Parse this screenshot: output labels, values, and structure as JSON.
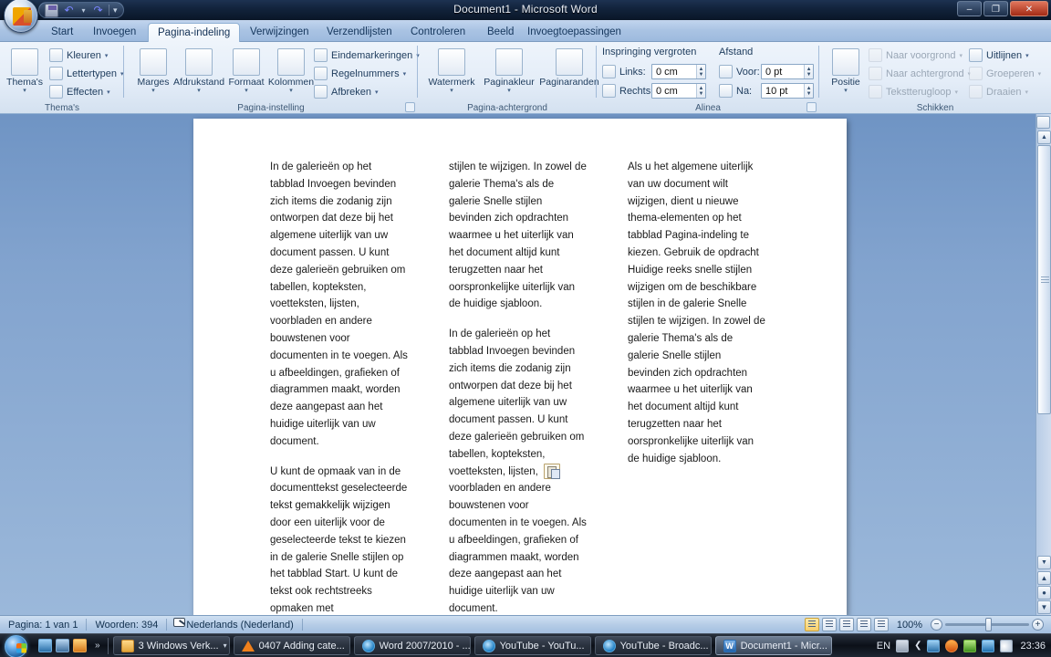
{
  "window": {
    "title": "Document1 - Microsoft Word",
    "minimize_label": "–",
    "restore_label": "❐",
    "close_label": "✕"
  },
  "quick_access": {
    "save_name": "save-icon",
    "undo_name": "undo-icon",
    "redo_name": "redo-icon",
    "customize_label": "▾"
  },
  "tabs": [
    {
      "label": "Start",
      "active": false
    },
    {
      "label": "Invoegen",
      "active": false
    },
    {
      "label": "Pagina-indeling",
      "active": true
    },
    {
      "label": "Verwijzingen",
      "active": false
    },
    {
      "label": "Verzendlijsten",
      "active": false
    },
    {
      "label": "Controleren",
      "active": false
    },
    {
      "label": "Beeld",
      "active": false
    },
    {
      "label": "Invoegtoepassingen",
      "active": false
    }
  ],
  "ribbon": {
    "groups": [
      {
        "name": "Thema's",
        "label": "Thema's",
        "big_buttons": [
          {
            "label": "Thema's",
            "arrow": "▾"
          }
        ],
        "small_buttons": [
          {
            "label": "Kleuren",
            "caret": "▾",
            "dim": false
          },
          {
            "label": "Lettertypen",
            "caret": "▾",
            "dim": false
          },
          {
            "label": "Effecten",
            "caret": "▾",
            "dim": false
          }
        ]
      },
      {
        "name": "Pagina-instelling",
        "label": "Pagina-instelling",
        "big_buttons": [
          {
            "label": "Marges",
            "arrow": "▾"
          },
          {
            "label": "Afdrukstand",
            "arrow": "▾"
          },
          {
            "label": "Formaat",
            "arrow": "▾"
          },
          {
            "label": "Kolommen",
            "arrow": "▾"
          }
        ],
        "small_buttons": [
          {
            "label": "Eindemarkeringen",
            "caret": "▾",
            "dim": false
          },
          {
            "label": "Regelnummers",
            "caret": "▾",
            "dim": false
          },
          {
            "label": "Afbreken",
            "caret": "▾",
            "dim": false
          }
        ],
        "dialog_launcher": "⤵"
      },
      {
        "name": "Pagina-achtergrond",
        "label": "Pagina-achtergrond",
        "big_buttons": [
          {
            "label": "Watermerk",
            "arrow": "▾"
          },
          {
            "label": "Paginakleur",
            "arrow": "▾"
          },
          {
            "label": "Paginaranden",
            "arrow": ""
          }
        ]
      },
      {
        "name": "Alinea",
        "label": "Alinea",
        "dialog_launcher": "⤵",
        "subtitles": [
          "Inspringing vergroten",
          "Afstand"
        ],
        "fields": [
          {
            "label": "Links:",
            "value": "0 cm"
          },
          {
            "label": "Rechts:",
            "value": "0 cm"
          },
          {
            "label": "Voor:",
            "value": "0 pt"
          },
          {
            "label": "Na:",
            "value": "10 pt"
          }
        ]
      },
      {
        "name": "Schikken",
        "label": "Schikken",
        "big_buttons": [
          {
            "label": "Positie",
            "arrow": "▾"
          }
        ],
        "small_buttons": [
          {
            "label": "Naar voorgrond",
            "caret": "▾",
            "dim": true
          },
          {
            "label": "Naar achtergrond",
            "caret": "▾",
            "dim": true
          },
          {
            "label": "Tekstterugloop",
            "caret": "▾",
            "dim": true
          },
          {
            "label": "Uitlijnen",
            "caret": "▾",
            "dim": false
          },
          {
            "label": "Groeperen",
            "caret": "▾",
            "dim": true
          },
          {
            "label": "Draaien",
            "caret": "▾",
            "dim": true
          }
        ]
      }
    ]
  },
  "document": {
    "columns": [
      {
        "paragraphs": [
          "In de galerieën op het tabblad Invoegen bevinden zich items die zodanig zijn ontworpen dat deze bij het algemene uiterlijk van uw document passen. U kunt deze galerieën gebruiken om tabellen, kopteksten, voetteksten, lijsten, voorbladen en andere bouwstenen voor documenten in te voegen. Als u afbeeldingen, grafieken of diagrammen maakt, worden deze aangepast aan het huidige uiterlijk van uw document.",
          "U kunt de opmaak van in de documenttekst geselecteerde tekst gemakkelijk wijzigen door een uiterlijk voor de geselecteerde tekst te kiezen in de galerie Snelle stijlen op het tabblad Start. U kunt de tekst ook rechtstreeks opmaken met"
        ]
      },
      {
        "paragraphs": [
          "stijlen te wijzigen. In zowel de galerie Thema's als de galerie Snelle stijlen bevinden zich opdrachten waarmee u het uiterlijk van het document altijd kunt terugzetten naar het oorspronkelijke uiterlijk van de huidige sjabloon.",
          "In de galerieën op het tabblad Invoegen bevinden zich items die zodanig zijn ontworpen dat deze bij het algemene uiterlijk van uw document passen. U kunt deze galerieën gebruiken om tabellen, kopteksten, voetteksten, lijsten, voorbladen en andere bouwstenen voor documenten in te voegen. Als u afbeeldingen, grafieken of diagrammen maakt, worden deze aangepast aan het huidige uiterlijk van uw document."
        ]
      },
      {
        "paragraphs": [
          "Als u het algemene uiterlijk van uw document wilt wijzigen, dient u nieuwe thema-elementen op het tabblad Pagina-indeling te kiezen. Gebruik de opdracht Huidige reeks snelle stijlen wijzigen om de beschikbare stijlen in de galerie Snelle stijlen te wijzigen. In zowel de galerie Thema's als de galerie Snelle stijlen bevinden zich opdrachten waarmee u het uiterlijk van het document altijd kunt terugzetten naar het oorspronkelijke uiterlijk van de huidige sjabloon."
        ]
      }
    ],
    "paste_options_icon": "paste-options-icon"
  },
  "status_bar": {
    "page": "Pagina: 1 van 1",
    "words": "Woorden: 394",
    "proofing_icon": "proofing-errors-icon",
    "language": "Nederlands (Nederland)",
    "zoom_level": "100%",
    "zoom_out": "−",
    "zoom_in": "+",
    "views": [
      "print-layout-view-button",
      "full-screen-reading-view-button",
      "web-layout-view-button",
      "outline-view-button",
      "draft-view-button"
    ]
  },
  "taskbar": {
    "start_label": "start-orb",
    "quick_launch": [
      "show-desktop-icon",
      "flip-3d-icon",
      "media-player-icon"
    ],
    "overflow_label": "»",
    "items": [
      {
        "label": "3 Windows Verk...",
        "icon": "folder-icon",
        "active": false,
        "caret": "▾"
      },
      {
        "label": "0407 Adding cate...",
        "icon": "vlc-icon",
        "active": false,
        "caret": ""
      },
      {
        "label": "Word 2007/2010 - ...",
        "icon": "ie-icon",
        "active": false,
        "caret": ""
      },
      {
        "label": "YouTube - YouTu...",
        "icon": "ie-icon",
        "active": false,
        "caret": ""
      },
      {
        "label": "YouTube - Broadc...",
        "icon": "ie-icon",
        "active": false,
        "caret": ""
      },
      {
        "label": "Document1 - Micr...",
        "icon": "word-icon",
        "active": true,
        "caret": ""
      }
    ],
    "tray": {
      "language": "EN",
      "clock": "23:36",
      "icons": [
        "keyboard-icon",
        "show-hidden-icons-chevron",
        "network-icon",
        "firefox-icon",
        "antivirus-icon",
        "network-status-icon",
        "volume-icon"
      ]
    }
  },
  "colors": {
    "accent": "#9dbade",
    "ribbon_bg": "#e4edf8",
    "desk_bg": "#82a3ce",
    "close_red": "#a32b15"
  }
}
